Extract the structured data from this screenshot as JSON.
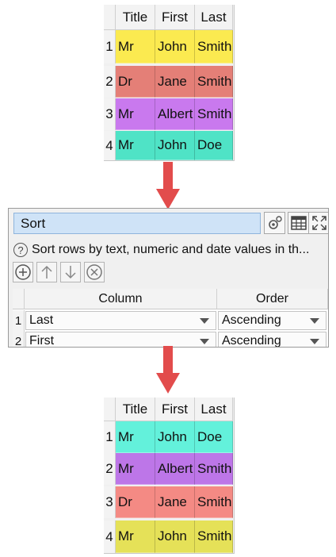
{
  "before_table": {
    "headers": [
      "Title",
      "First",
      "Last"
    ],
    "rows": [
      {
        "index": "1",
        "title": "Mr",
        "first": "John",
        "last": "Smith",
        "color": "#fbea50"
      },
      {
        "index": "2",
        "title": "Dr",
        "first": "Jane",
        "last": "Smith",
        "color": "#e47f77"
      },
      {
        "index": "3",
        "title": "Mr",
        "first": "Albert",
        "last": "Smith",
        "color": "#c979ee"
      },
      {
        "index": "4",
        "title": "Mr",
        "first": "John",
        "last": "Doe",
        "color": "#4fe3c6"
      }
    ]
  },
  "sort_panel": {
    "name": "Sort",
    "description": "Sort rows by text, numeric and date values in th...",
    "help_icon": "?",
    "tool_icons": [
      "settings-icon",
      "table-icon",
      "expand-icon"
    ],
    "action_icons": [
      "add-icon",
      "up-arrow-icon",
      "down-arrow-icon",
      "remove-icon"
    ],
    "columns": [
      "Column",
      "Order"
    ],
    "rows": [
      {
        "index": "1",
        "column": "Last",
        "order": "Ascending"
      },
      {
        "index": "2",
        "column": "First",
        "order": "Ascending"
      }
    ]
  },
  "after_table": {
    "headers": [
      "Title",
      "First",
      "Last"
    ],
    "rows": [
      {
        "index": "1",
        "title": "Mr",
        "first": "John",
        "last": "Doe",
        "color": "#63f1db"
      },
      {
        "index": "2",
        "title": "Mr",
        "first": "Albert",
        "last": "Smith",
        "color": "#bd76e8"
      },
      {
        "index": "3",
        "title": "Dr",
        "first": "Jane",
        "last": "Smith",
        "color": "#f48a84"
      },
      {
        "index": "4",
        "title": "Mr",
        "first": "John",
        "last": "Smith",
        "color": "#e5e158"
      }
    ]
  },
  "arrow_color": "#e24c4c"
}
